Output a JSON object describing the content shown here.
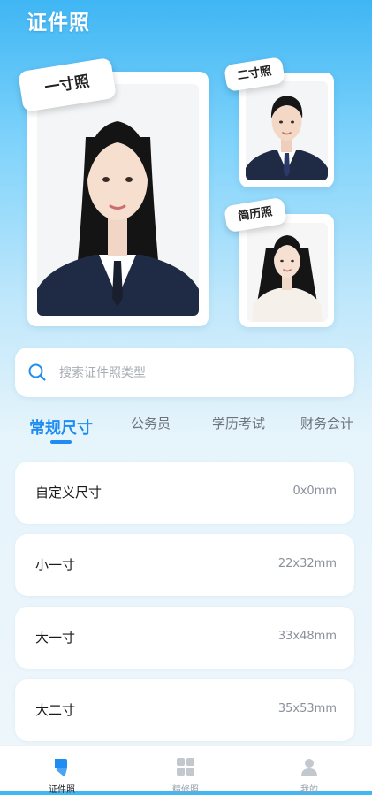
{
  "app": {
    "title": "证件照"
  },
  "showcase": {
    "one_inch": {
      "tag": "一寸照"
    },
    "two_inch": {
      "tag": "二寸照"
    },
    "resume": {
      "tag": "简历照"
    }
  },
  "search": {
    "placeholder": "搜索证件照类型"
  },
  "tabs": [
    {
      "label": "常规尺寸",
      "active": true
    },
    {
      "label": "公务员",
      "active": false
    },
    {
      "label": "学历考试",
      "active": false
    },
    {
      "label": "财务会计",
      "active": false
    }
  ],
  "sizes": [
    {
      "name": "自定义尺寸",
      "dim": "0x0mm"
    },
    {
      "name": "小一寸",
      "dim": "22x32mm"
    },
    {
      "name": "大一寸",
      "dim": "33x48mm"
    },
    {
      "name": "大二寸",
      "dim": "35x53mm"
    }
  ],
  "bottom_nav": [
    {
      "label": "证件照",
      "icon": "id-photo-icon",
      "active": true
    },
    {
      "label": "精修照",
      "icon": "grid-icon",
      "active": false
    },
    {
      "label": "我的",
      "icon": "user-icon",
      "active": false
    }
  ],
  "colors": {
    "accent": "#1e8cf0",
    "navy_suit": "#1f2a44",
    "photo_bg": "#f3f4f6"
  }
}
